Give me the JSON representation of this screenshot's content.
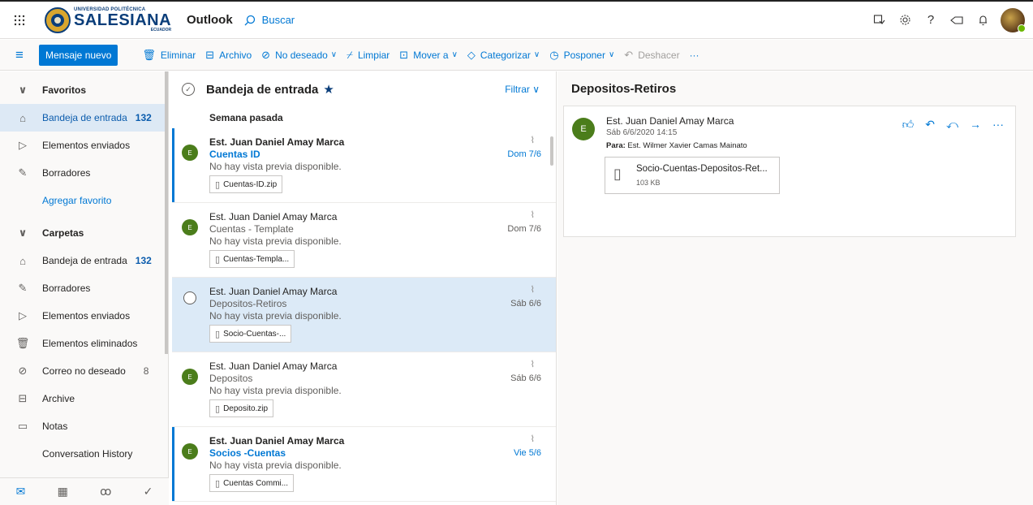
{
  "header": {
    "logo_top": "UNIVERSIDAD POLITÉCNICA",
    "logo_main": "SALESIANA",
    "logo_sub": "ECUADOR",
    "app_name": "Outlook",
    "search_placeholder": "Buscar"
  },
  "toolbar": {
    "new_message": "Mensaje nuevo",
    "delete": "Eliminar",
    "archive": "Archivo",
    "junk": "No deseado",
    "sweep": "Limpiar",
    "move": "Mover a",
    "categorize": "Categorizar",
    "snooze": "Posponer",
    "undo": "Deshacer",
    "more": "···"
  },
  "nav": {
    "favorites": "Favoritos",
    "fav_inbox": "Bandeja de entrada",
    "fav_inbox_count": "132",
    "fav_sent": "Elementos enviados",
    "fav_drafts": "Borradores",
    "add_favorite": "Agregar favorito",
    "folders": "Carpetas",
    "inbox": "Bandeja de entrada",
    "inbox_count": "132",
    "drafts": "Borradores",
    "sent": "Elementos enviados",
    "deleted": "Elementos eliminados",
    "junk": "Correo no deseado",
    "junk_count": "8",
    "archive": "Archive",
    "notes": "Notas",
    "conversation_history": "Conversation History"
  },
  "list": {
    "title": "Bandeja de entrada",
    "filter": "Filtrar",
    "group": "Semana pasada",
    "mails": [
      {
        "from": "Est. Juan Daniel Amay Marca",
        "subject": "Cuentas ID",
        "preview": "No hay vista previa disponible.",
        "attachment": "Cuentas-ID.zip",
        "date": "Dom 7/6",
        "initial": "E"
      },
      {
        "from": "Est. Juan Daniel Amay Marca",
        "subject": "Cuentas - Template",
        "preview": "No hay vista previa disponible.",
        "attachment": "Cuentas-Templa...",
        "date": "Dom 7/6",
        "initial": "E"
      },
      {
        "from": "Est. Juan Daniel Amay Marca",
        "subject": "Depositos-Retiros",
        "preview": "No hay vista previa disponible.",
        "attachment": "Socio-Cuentas-...",
        "date": "Sáb 6/6",
        "initial": "E"
      },
      {
        "from": "Est. Juan Daniel Amay Marca",
        "subject": "Depositos",
        "preview": "No hay vista previa disponible.",
        "attachment": "Deposito.zip",
        "date": "Sáb 6/6",
        "initial": "E"
      },
      {
        "from": "Est. Juan Daniel Amay Marca",
        "subject": "Socios -Cuentas",
        "preview": "No hay vista previa disponible.",
        "attachment": "Cuentas Commi...",
        "date": "Vie 5/6",
        "initial": "E"
      }
    ]
  },
  "reading": {
    "subject": "Depositos-Retiros",
    "initial": "E",
    "from": "Est. Juan Daniel Amay Marca",
    "datetime": "Sáb 6/6/2020 14:15",
    "to_label": "Para:",
    "to": "Est. Wilmer Xavier Camas Mainato",
    "attachment_name": "Socio-Cuentas-Depositos-Ret...",
    "attachment_size": "103 KB"
  }
}
